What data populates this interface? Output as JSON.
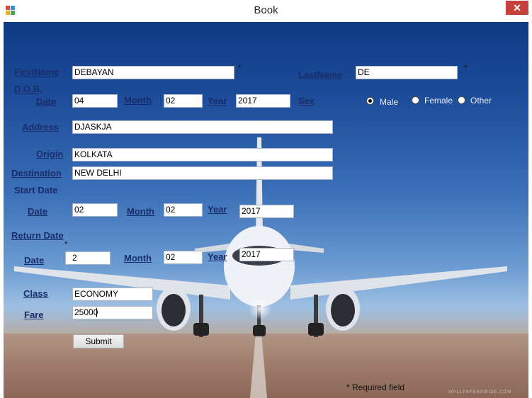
{
  "window": {
    "title": "Book",
    "close_label": "✕"
  },
  "form": {
    "firstname": {
      "label": "FirstName",
      "value": "DEBAYAN"
    },
    "lastname": {
      "label": "LastName",
      "value": "DE"
    },
    "dob": {
      "label": "D.O.B.",
      "date_label": "Date",
      "date_value": "04",
      "month_label": "Month",
      "month_value": "02",
      "year_label": "Year",
      "year_value": "2017"
    },
    "sex": {
      "label": "Sex",
      "options": [
        "Male",
        "Female",
        "Other"
      ],
      "selected": "Male"
    },
    "address": {
      "label": "Address",
      "value": "DJASKJA"
    },
    "origin": {
      "label": "Origin",
      "value": "KOLKATA"
    },
    "destination": {
      "label": "Destination",
      "value": "NEW DELHI"
    },
    "start": {
      "label": "Start Date",
      "date_label": "Date",
      "date_value": "02",
      "month_label": "Month",
      "month_value": "02",
      "year_label": "Year",
      "year_value": "2017"
    },
    "return": {
      "label": "Return Date",
      "date_label": "Date",
      "date_value": "2",
      "month_label": "Month",
      "month_value": "02",
      "year_label": "Year",
      "year_value": "2017"
    },
    "class": {
      "label": "Class",
      "value": "ECONOMY"
    },
    "fare": {
      "label": "Fare",
      "value": "25000"
    },
    "required_mark": "*",
    "submit_label": "Submit",
    "required_note": "* Required field"
  },
  "background": {
    "watermark": "WALLPAPERSWIDE.COM"
  },
  "colors": {
    "label_text": "#1a2c6a",
    "close_button": "#c7413c",
    "sky": "#1d4c9a"
  }
}
